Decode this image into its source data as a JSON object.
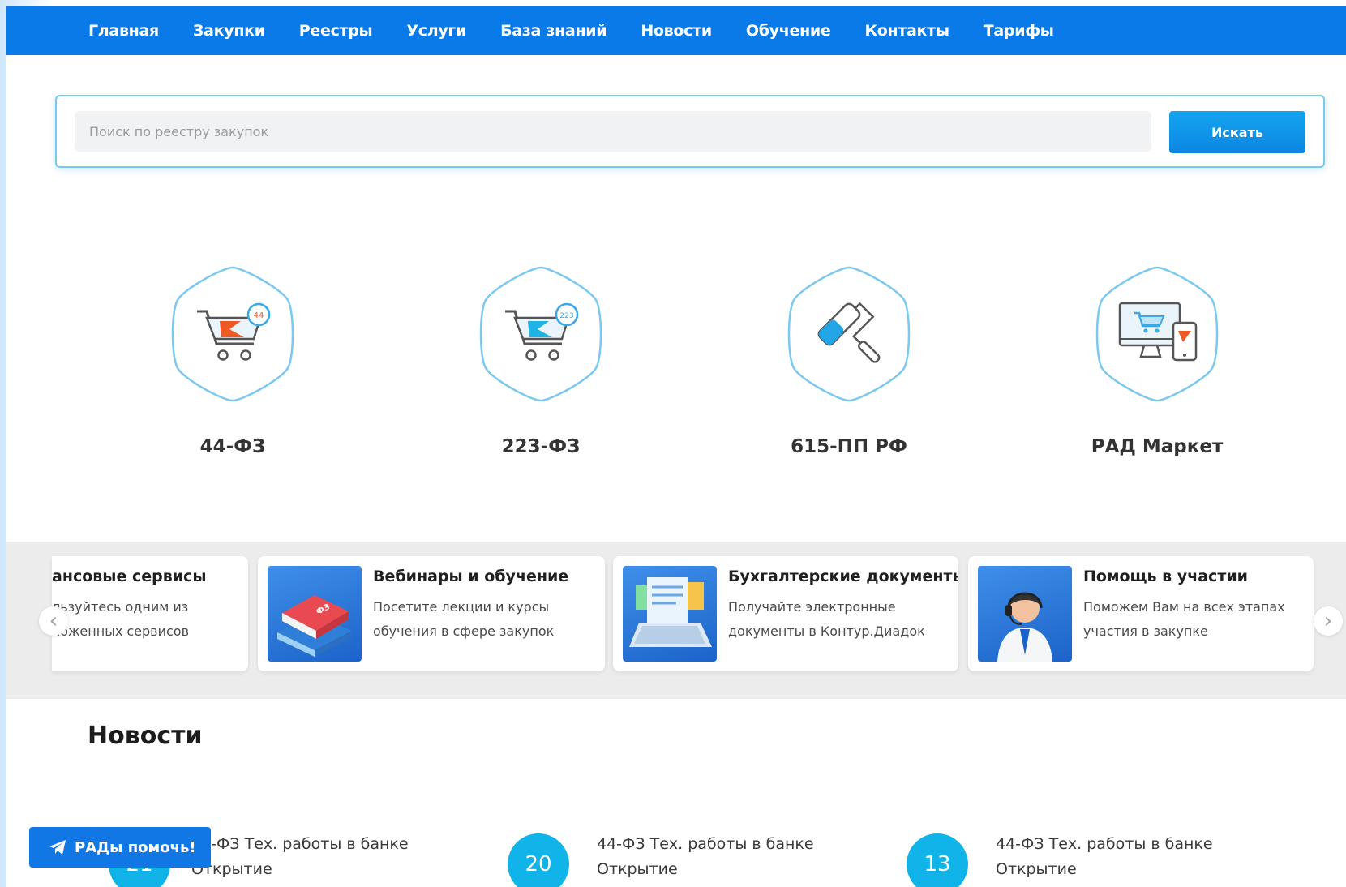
{
  "nav": {
    "items": [
      "Главная",
      "Закупки",
      "Реестры",
      "Услуги",
      "База знаний",
      "Новости",
      "Обучение",
      "Контакты",
      "Тарифы"
    ]
  },
  "search": {
    "placeholder": "Поиск по реестру закупок",
    "button_label": "Искать"
  },
  "categories": [
    {
      "label": "44-ФЗ",
      "icon": "cart-44-icon",
      "badge": "44"
    },
    {
      "label": "223-ФЗ",
      "icon": "cart-223-icon",
      "badge": "223"
    },
    {
      "label": "615-ПП РФ",
      "icon": "paint-roller-icon"
    },
    {
      "label": "РАД Маркет",
      "icon": "computer-shop-icon"
    }
  ],
  "services": [
    {
      "title": "ансовые сервисы",
      "desc": "льзуйтесь одним из ложенных сервисов"
    },
    {
      "title": "Вебинары и обучение",
      "desc": "Посетите лекции и курсы обучения в сфере закупок",
      "icon": "books-icon",
      "book_text": "ФЗ"
    },
    {
      "title": "Бухгалтерские документы",
      "desc": "Получайте электронные документы в Контур.Диадок",
      "icon": "laptop-documents-icon"
    },
    {
      "title": "Помощь в участии",
      "desc": "Поможем Вам на всех этапах участия в закупке",
      "icon": "support-operator-icon"
    }
  ],
  "carousel": {
    "prev_icon": "chevron-left-icon",
    "next_icon": "chevron-right-icon",
    "prev": "‹",
    "next": "›"
  },
  "news": {
    "heading": "Новости",
    "items": [
      {
        "day": "21",
        "text": "44-ФЗ Тех. работы в банке Открытие"
      },
      {
        "day": "20",
        "text": "44-ФЗ Тех. работы в банке Открытие"
      },
      {
        "day": "13",
        "text": "44-ФЗ Тех. работы в банке Открытие"
      }
    ]
  },
  "helper": {
    "label": "РАДы помочь!",
    "icon": "telegram-plane-icon"
  },
  "colors": {
    "primary": "#0a7ae8",
    "accent": "#11b4e8",
    "hex_border": "#7cc8ee",
    "orange": "#ef5a24"
  }
}
